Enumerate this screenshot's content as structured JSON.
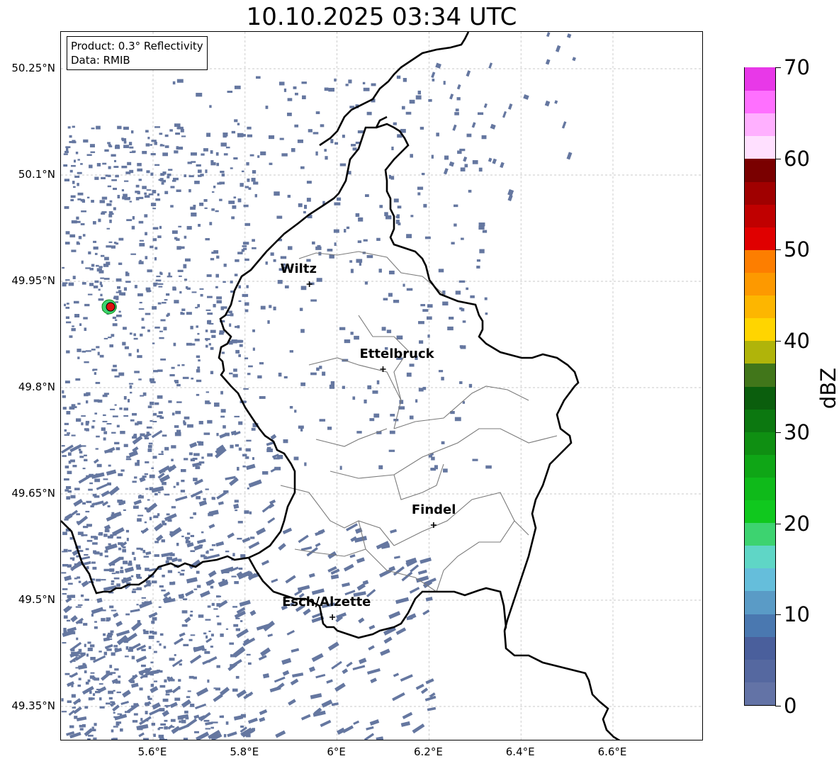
{
  "title": "10.10.2025 03:34 UTC",
  "info": {
    "product": "Product: 0.3° Reflectivity",
    "data": "Data: RMIB"
  },
  "lat_labels": [
    "50.25°N",
    "50.1°N",
    "49.95°N",
    "49.8°N",
    "49.65°N",
    "49.5°N",
    "49.35°N"
  ],
  "lon_labels": [
    "5.6°E",
    "5.8°E",
    "6°E",
    "6.2°E",
    "6.4°E",
    "6.6°E"
  ],
  "cities": [
    {
      "name": "Wiltz",
      "lon": 5.94,
      "lat": 49.97
    },
    {
      "name": "Ettelbruck",
      "lon": 6.1,
      "lat": 49.85
    },
    {
      "name": "Findel",
      "lon": 6.21,
      "lat": 49.63
    },
    {
      "name": "Esch/Alzette",
      "lon": 5.99,
      "lat": 49.5
    }
  ],
  "colorbar": {
    "label": "dBZ",
    "min": 0,
    "max": 70,
    "ticks": [
      "0",
      "10",
      "20",
      "30",
      "40",
      "50",
      "60",
      "70"
    ],
    "colors": [
      "#6373a6",
      "#5568a0",
      "#4a5f9c",
      "#4a78b0",
      "#5a9bc6",
      "#65bedb",
      "#5fd6c6",
      "#3dd370",
      "#10c81e",
      "#0fba1a",
      "#0fa616",
      "#0f8f12",
      "#0c7810",
      "#0b5e0d",
      "#41761a",
      "#b0b40a",
      "#ffd500",
      "#fdb600",
      "#fd9900",
      "#fd7e00",
      "#e00000",
      "#c00000",
      "#a00000",
      "#7a0000",
      "#ffe0ff",
      "#ffb0ff",
      "#ff70ff",
      "#e838e8"
    ]
  },
  "radar_site_color": "#e01010",
  "echo_color": "#6577a0"
}
